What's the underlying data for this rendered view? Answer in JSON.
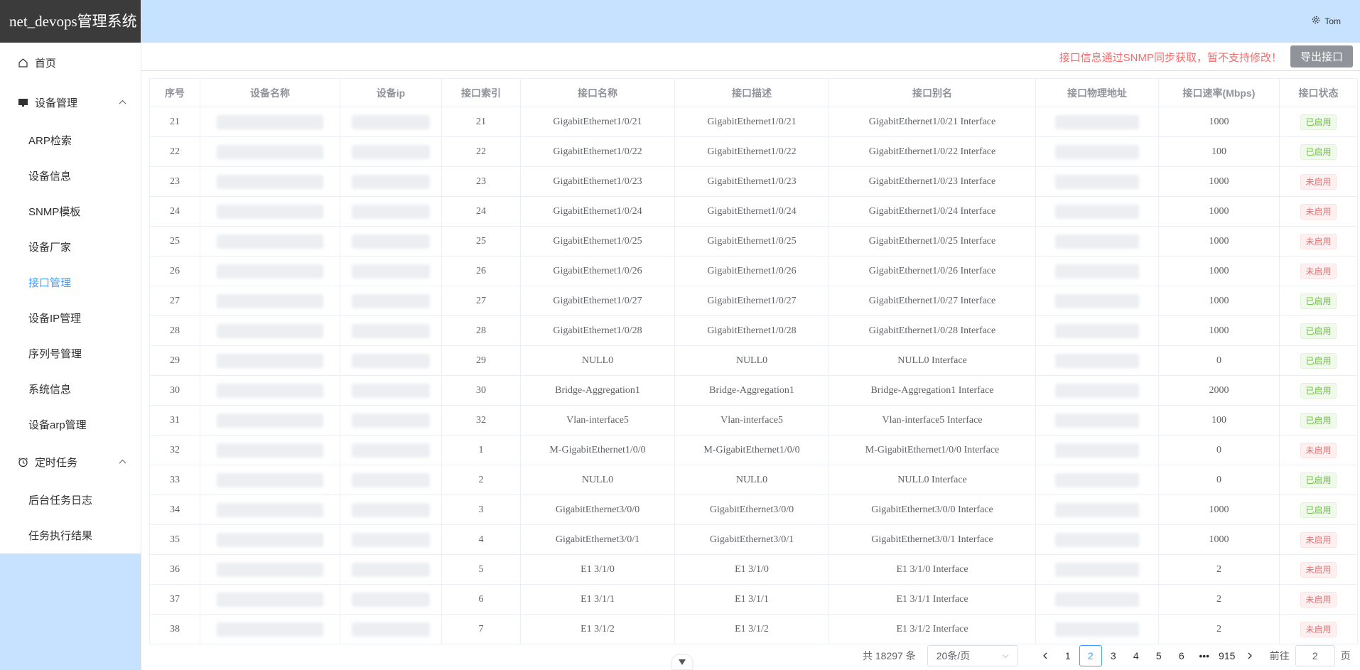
{
  "app": {
    "title": "net_devops管理系统"
  },
  "header": {
    "user_name": "Tom"
  },
  "sidebar": {
    "items": [
      {
        "label": "首页",
        "type": "top",
        "icon": "home-icon"
      },
      {
        "label": "设备管理",
        "type": "top",
        "icon": "monitor-icon",
        "expanded": true
      },
      {
        "label": "ARP检索",
        "type": "sub"
      },
      {
        "label": "设备信息",
        "type": "sub"
      },
      {
        "label": "SNMP模板",
        "type": "sub"
      },
      {
        "label": "设备厂家",
        "type": "sub"
      },
      {
        "label": "接口管理",
        "type": "sub",
        "active": true
      },
      {
        "label": "设备IP管理",
        "type": "sub"
      },
      {
        "label": "序列号管理",
        "type": "sub"
      },
      {
        "label": "系统信息",
        "type": "sub"
      },
      {
        "label": "设备arp管理",
        "type": "sub"
      },
      {
        "label": "定时任务",
        "type": "top",
        "icon": "alarm-clock-icon",
        "expanded": true
      },
      {
        "label": "后台任务日志",
        "type": "sub"
      },
      {
        "label": "任务执行结果",
        "type": "sub"
      }
    ]
  },
  "toolbar": {
    "notice": "接口信息通过SNMP同步获取，暂不支持修改！",
    "export_label": "导出接口"
  },
  "table": {
    "columns": [
      "序号",
      "设备名称",
      "设备ip",
      "接口索引",
      "接口名称",
      "接口描述",
      "接口别名",
      "接口物理地址",
      "接口速率(Mbps)",
      "接口状态"
    ],
    "rows": [
      [
        "21",
        "",
        "",
        "21",
        "GigabitEthernet1/0/21",
        "GigabitEthernet1/0/21",
        "GigabitEthernet1/0/21 Interface",
        "",
        "1000",
        "已启用"
      ],
      [
        "22",
        "",
        "",
        "22",
        "GigabitEthernet1/0/22",
        "GigabitEthernet1/0/22",
        "GigabitEthernet1/0/22 Interface",
        "",
        "100",
        "已启用"
      ],
      [
        "23",
        "",
        "",
        "23",
        "GigabitEthernet1/0/23",
        "GigabitEthernet1/0/23",
        "GigabitEthernet1/0/23 Interface",
        "",
        "1000",
        "未启用"
      ],
      [
        "24",
        "",
        "",
        "24",
        "GigabitEthernet1/0/24",
        "GigabitEthernet1/0/24",
        "GigabitEthernet1/0/24 Interface",
        "",
        "1000",
        "未启用"
      ],
      [
        "25",
        "",
        "",
        "25",
        "GigabitEthernet1/0/25",
        "GigabitEthernet1/0/25",
        "GigabitEthernet1/0/25 Interface",
        "",
        "1000",
        "未启用"
      ],
      [
        "26",
        "",
        "",
        "26",
        "GigabitEthernet1/0/26",
        "GigabitEthernet1/0/26",
        "GigabitEthernet1/0/26 Interface",
        "",
        "1000",
        "未启用"
      ],
      [
        "27",
        "",
        "",
        "27",
        "GigabitEthernet1/0/27",
        "GigabitEthernet1/0/27",
        "GigabitEthernet1/0/27 Interface",
        "",
        "1000",
        "已启用"
      ],
      [
        "28",
        "",
        "",
        "28",
        "GigabitEthernet1/0/28",
        "GigabitEthernet1/0/28",
        "GigabitEthernet1/0/28 Interface",
        "",
        "1000",
        "已启用"
      ],
      [
        "29",
        "",
        "",
        "29",
        "NULL0",
        "NULL0",
        "NULL0 Interface",
        "",
        "0",
        "已启用"
      ],
      [
        "30",
        "",
        "",
        "30",
        "Bridge-Aggregation1",
        "Bridge-Aggregation1",
        "Bridge-Aggregation1 Interface",
        "",
        "2000",
        "已启用"
      ],
      [
        "31",
        "",
        "",
        "32",
        "Vlan-interface5",
        "Vlan-interface5",
        "Vlan-interface5 Interface",
        "",
        "100",
        "已启用"
      ],
      [
        "32",
        "",
        "",
        "1",
        "M-GigabitEthernet1/0/0",
        "M-GigabitEthernet1/0/0",
        "M-GigabitEthernet1/0/0 Interface",
        "",
        "0",
        "未启用"
      ],
      [
        "33",
        "",
        "",
        "2",
        "NULL0",
        "NULL0",
        "NULL0 Interface",
        "",
        "0",
        "已启用"
      ],
      [
        "34",
        "",
        "",
        "3",
        "GigabitEthernet3/0/0",
        "GigabitEthernet3/0/0",
        "GigabitEthernet3/0/0 Interface",
        "",
        "1000",
        "已启用"
      ],
      [
        "35",
        "",
        "",
        "4",
        "GigabitEthernet3/0/1",
        "GigabitEthernet3/0/1",
        "GigabitEthernet3/0/1 Interface",
        "",
        "1000",
        "未启用"
      ],
      [
        "36",
        "",
        "",
        "5",
        "E1 3/1/0",
        "E1 3/1/0",
        "E1 3/1/0 Interface",
        "",
        "2",
        "未启用"
      ],
      [
        "37",
        "",
        "",
        "6",
        "E1 3/1/1",
        "E1 3/1/1",
        "E1 3/1/1 Interface",
        "",
        "2",
        "未启用"
      ],
      [
        "38",
        "",
        "",
        "7",
        "E1 3/1/2",
        "E1 3/1/2",
        "E1 3/1/2 Interface",
        "",
        "2",
        "未启用"
      ]
    ],
    "status_enabled": "已启用",
    "status_disabled": "未启用"
  },
  "pagination": {
    "total_text": "共 18297 条",
    "page_size": "20条/页",
    "pages": [
      "1",
      "2",
      "3",
      "4",
      "5",
      "6",
      "•••",
      "915"
    ],
    "current": "2",
    "goto_prefix": "前往",
    "goto_value": "2",
    "goto_suffix": "页"
  },
  "colors": {
    "accent": "#409eff",
    "sidebar_bg": "#c6e2ff",
    "logo_bg": "#3b3b3b",
    "danger": "#f56c6c",
    "success": "#67c23a"
  }
}
